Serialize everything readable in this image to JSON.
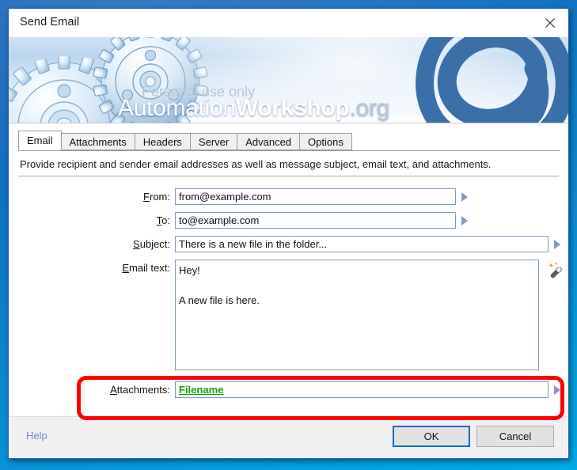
{
  "window": {
    "title": "Send Email",
    "close_icon": "close-icon"
  },
  "banner": {
    "brand_part1": "Automation",
    "brand_part2": "Workshop",
    "brand_part3": ".org",
    "tagline": "Personal use only",
    "logo_icon": "at-sign-logo",
    "gears_icon": "gears-illustration",
    "accent_blue": "#3a6fa8"
  },
  "tabs": [
    {
      "label": "Email",
      "active": true
    },
    {
      "label": "Attachments",
      "active": false
    },
    {
      "label": "Headers",
      "active": false
    },
    {
      "label": "Server",
      "active": false
    },
    {
      "label": "Advanced",
      "active": false
    },
    {
      "label": "Options",
      "active": false
    }
  ],
  "panel": {
    "hint": "Provide recipient and sender email addresses as well as message subject, email text, and attachments.",
    "fields": {
      "from": {
        "label_pre": "",
        "label_mnemonic": "F",
        "label_post": "rom:",
        "value": "from@example.com",
        "placeholder": ""
      },
      "to": {
        "label_pre": "",
        "label_mnemonic": "T",
        "label_post": "o:",
        "value": "to@example.com",
        "placeholder": ""
      },
      "subject": {
        "label_pre": "",
        "label_mnemonic": "S",
        "label_post": "ubject:",
        "value": "There is a new file in the folder...",
        "placeholder": ""
      },
      "email_text": {
        "label_pre": "",
        "label_mnemonic": "E",
        "label_post": "mail text:",
        "value": "Hey!\n\nA new file is here.",
        "placeholder": ""
      },
      "attachments": {
        "label_pre": "",
        "label_mnemonic": "A",
        "label_post": "ttachments:",
        "value": "Filename",
        "value_color": "#0da40d",
        "placeholder": ""
      }
    },
    "wand_icon": "magic-wand-icon",
    "dropdown_icon": "expand-arrow-icon"
  },
  "annotation": {
    "highlight_color": "#fe0000",
    "target": "attachments-row"
  },
  "footer": {
    "help": "Help",
    "ok": "OK",
    "cancel": "Cancel"
  }
}
